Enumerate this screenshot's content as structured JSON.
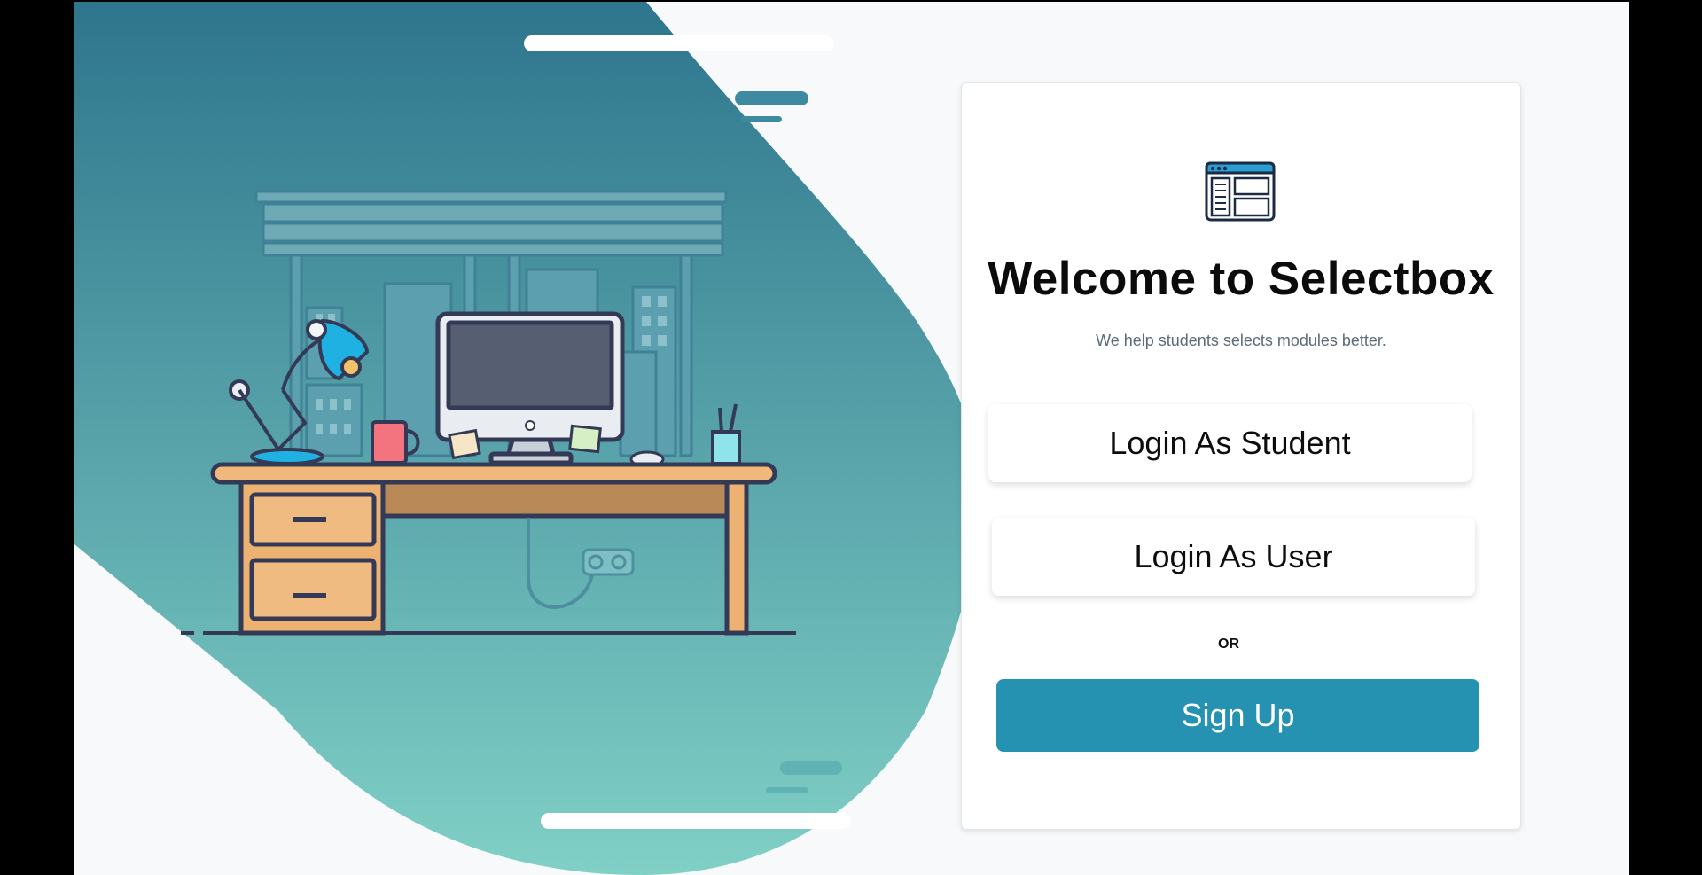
{
  "hero": {
    "blob_color_top": "#2e758d",
    "blob_color_bottom": "#80d0c6",
    "illustration": "desk-workspace-illustration"
  },
  "card": {
    "logo_icon": "browser-window-layout-icon",
    "title": "Welcome to Selectbox",
    "subtitle": "We help students selects modules better.",
    "login_student_label": "Login As Student",
    "login_user_label": "Login As User",
    "divider_text": "OR",
    "signup_label": "Sign Up",
    "accent_color": "#2492b0"
  }
}
